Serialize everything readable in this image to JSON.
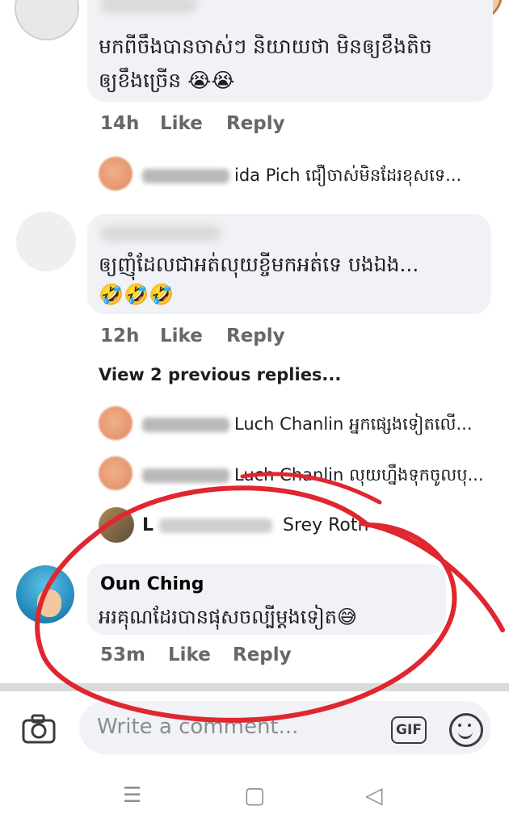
{
  "comments": [
    {
      "text_lines": [
        "មកពីចឹងបានចាស់ៗ និយាយថា មិនឲ្យខឹងតិច",
        "ឲ្យខឹងច្រើន 😭😭"
      ],
      "time": "14h",
      "like": "Like",
      "reply": "Reply"
    },
    {
      "text_lines": [
        "ឲ្យញុំដែលជាអត់លុយខ្ចីមកអត់ទេ បងឯង...",
        "🤣🤣🤣"
      ],
      "time": "12h",
      "like": "Like",
      "reply": "Reply"
    }
  ],
  "reply_preview_1": {
    "name_tail": "ida Pich",
    "text": "ជឿចាស់មិនដែរខុសទេ..."
  },
  "view_previous": "View 2 previous replies...",
  "reply_previews": [
    {
      "name": "Luch Chanlin",
      "text": "អ្នកផ្សេងទៀតលើ..."
    },
    {
      "name": "Luch Chanlin",
      "text": "លុយហ្នឹងទុកចូលបុ..."
    }
  ],
  "reply_luch": {
    "name_start": "L",
    "name_end": "Srey Roth"
  },
  "oun_comment": {
    "name": "Oun Ching",
    "text": "អរគុណដែរបានផុសចល្បីម្ដងទៀត😅",
    "time": "53m",
    "like": "Like",
    "reply": "Reply"
  },
  "composer": {
    "placeholder": "Write a comment...",
    "gif_label": "GIF"
  },
  "icons": {
    "camera": "camera-icon",
    "emoji": "smiley-icon",
    "gif": "gif-icon"
  },
  "nav": {
    "menu": "☰",
    "home": "▢",
    "back": "◁"
  },
  "colors": {
    "annotation": "#e0262f",
    "bubble": "#f0f2f5",
    "meta": "#65676b"
  }
}
